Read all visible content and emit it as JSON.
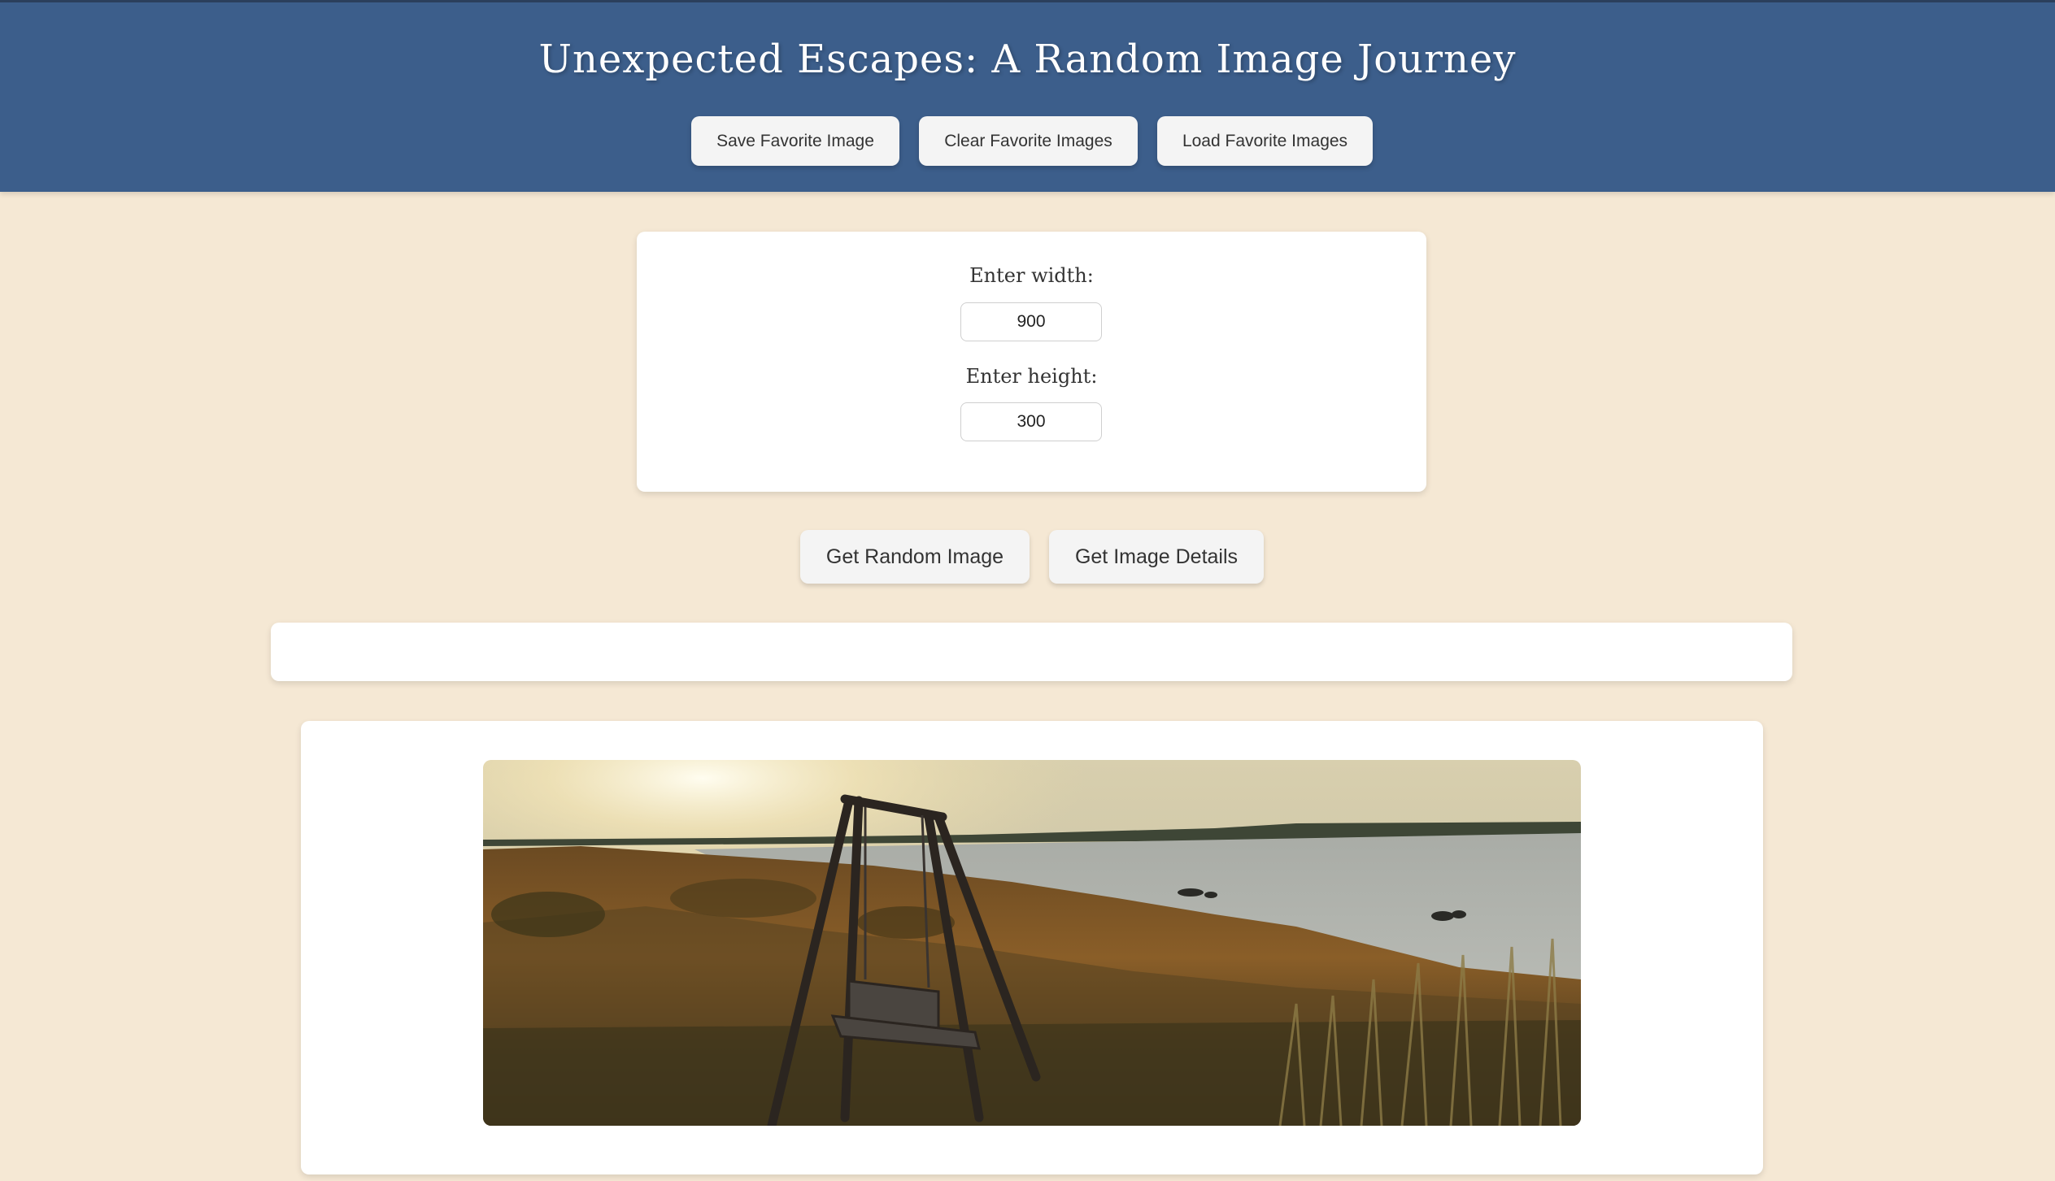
{
  "header": {
    "title": "Unexpected Escapes: A Random Image Journey",
    "buttons": {
      "save": "Save Favorite Image",
      "clear": "Clear Favorite Images",
      "load": "Load Favorite Images"
    }
  },
  "form": {
    "width_label": "Enter width:",
    "width_value": "900",
    "height_label": "Enter height:",
    "height_value": "300"
  },
  "actions": {
    "random": "Get Random Image",
    "details": "Get Image Details"
  },
  "details": {
    "text": ""
  },
  "image": {
    "scene": "coastal-sunset-swing-photo"
  },
  "colors": {
    "header_bg": "#3c5e8b",
    "page_bg": "#f5e8d4"
  }
}
